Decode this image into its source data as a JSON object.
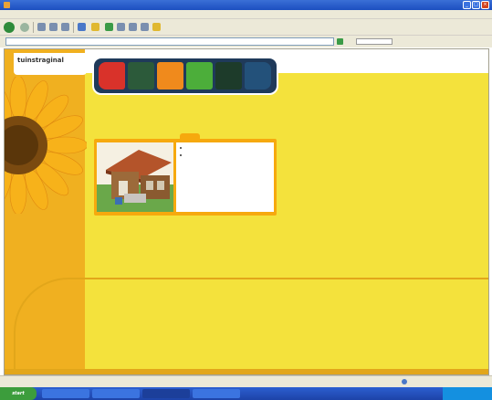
{
  "window": {
    "title": ""
  },
  "menu": [],
  "toolbar": {
    "back_label": "",
    "search_label": "",
    "favorites_label": ""
  },
  "address": {
    "label": "",
    "url": "",
    "go_label": "",
    "links_label": ""
  },
  "site": {
    "logo_text": "tuinstraginal",
    "nav": [
      {
        "label": "",
        "color": "#d9322a"
      },
      {
        "label": "",
        "color": "#2c5a3a"
      },
      {
        "label": "",
        "color": "#f08a1c"
      },
      {
        "label": "",
        "color": "#4cae3a"
      },
      {
        "label": "",
        "color": "#1d3b2a"
      },
      {
        "label": "",
        "color": "#23517a"
      }
    ],
    "intro_small": "",
    "intro_big": "",
    "product": {
      "descriptions": [
        "",
        ""
      ]
    },
    "footer_links": [
      "",
      "",
      ""
    ]
  },
  "statusbar": {
    "text": "",
    "zone": ""
  },
  "taskbar": {
    "start_label": "start",
    "items": [
      "",
      "",
      "",
      ""
    ],
    "clock": ""
  },
  "colors": {
    "page_yellow": "#f4e23c",
    "side_orange": "#f0b020",
    "panel_orange": "#f6a90e",
    "nav_dark": "#1f3a5a"
  }
}
